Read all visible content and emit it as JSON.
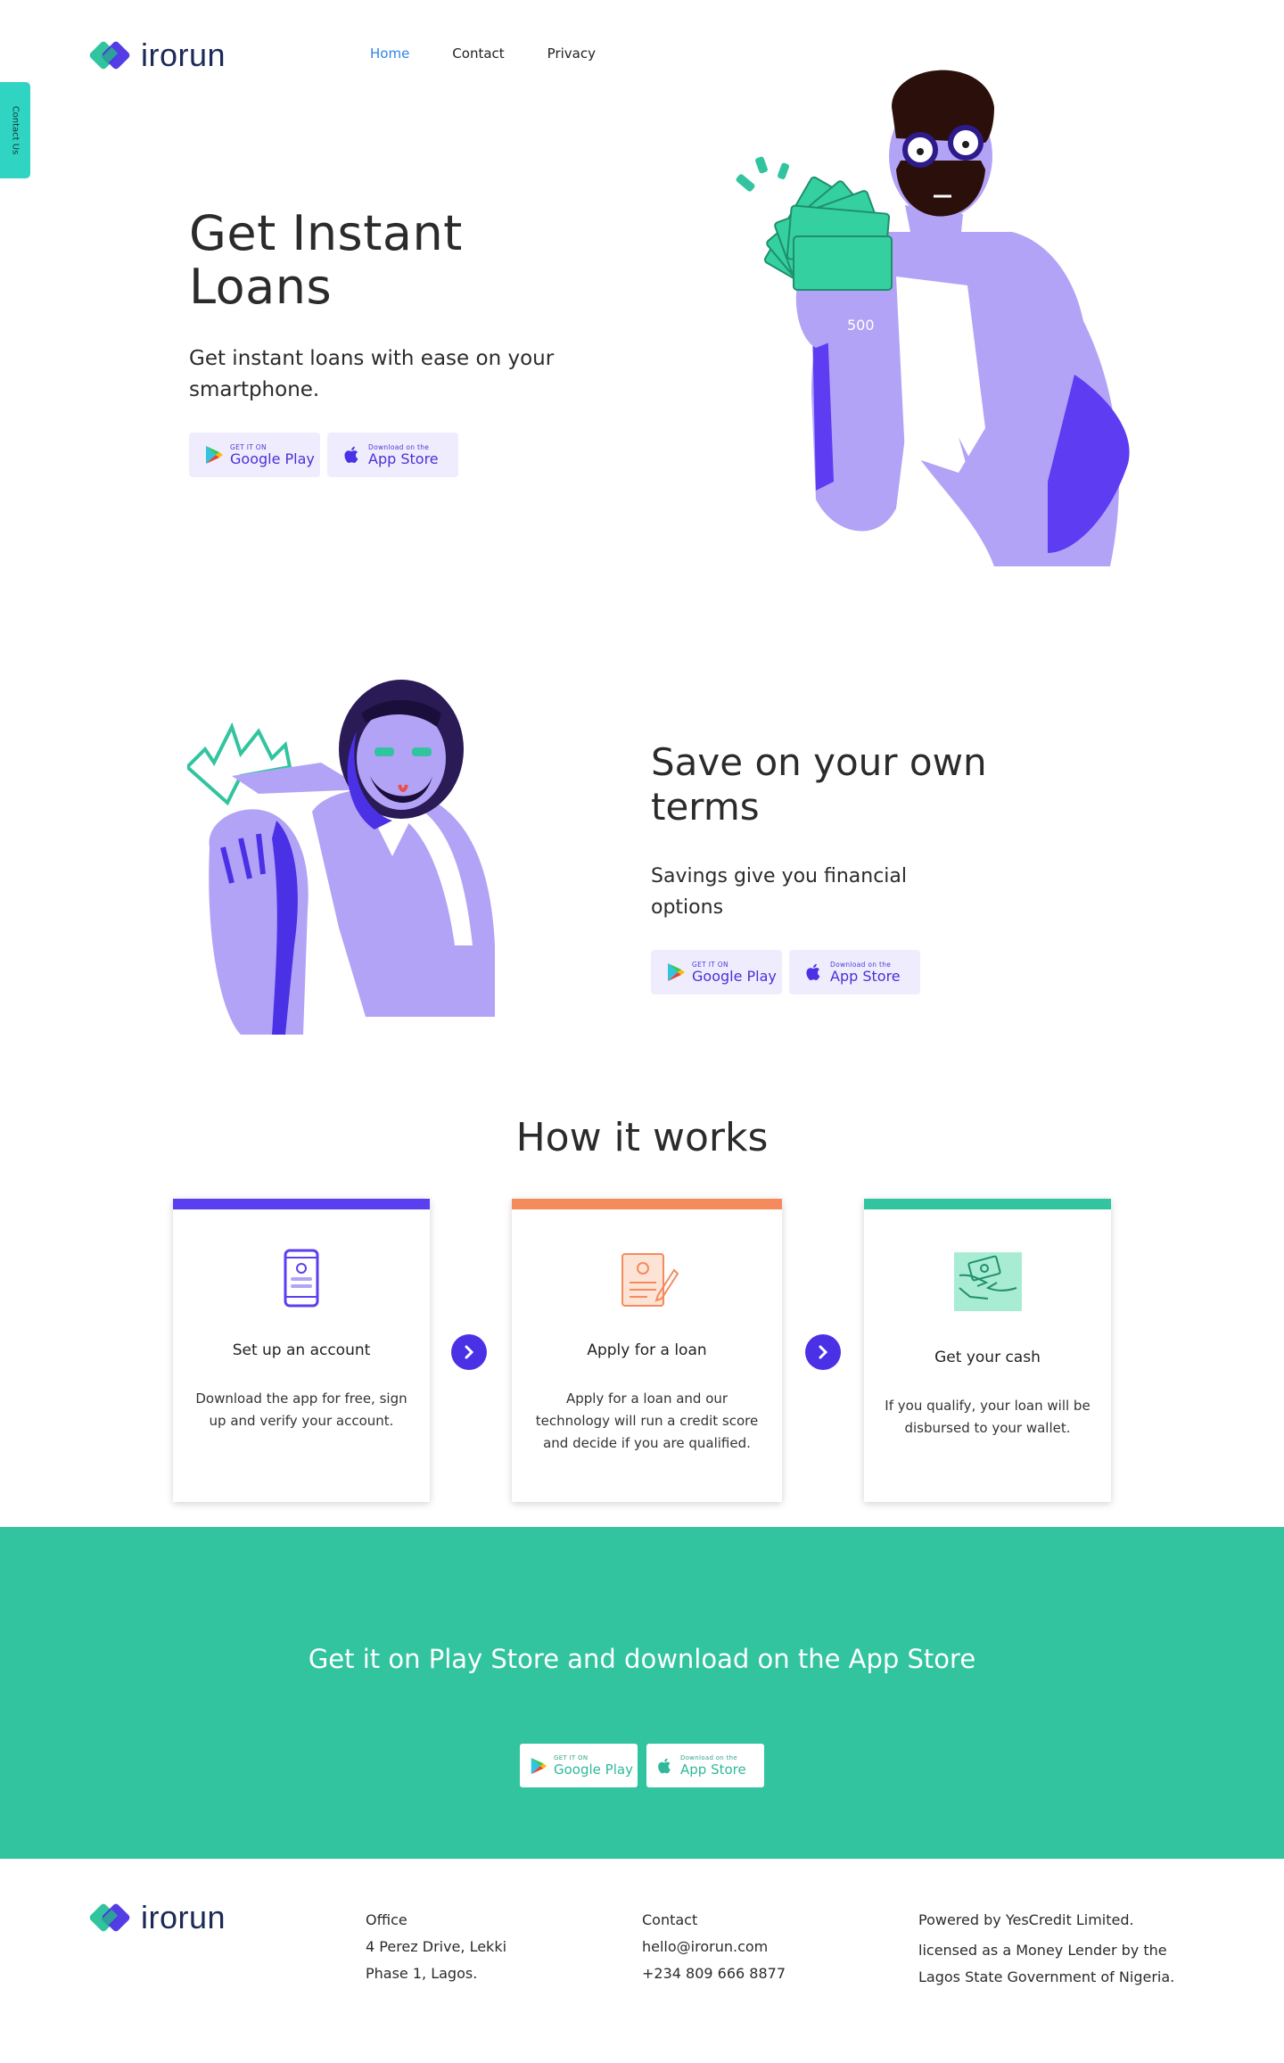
{
  "brand": {
    "name": "irorun",
    "accent": "#4b31e6",
    "teal": "#31c49f"
  },
  "nav": {
    "items": [
      "Home",
      "Contact",
      "Privacy"
    ],
    "active": "Home"
  },
  "contact_tab": {
    "label": "Contact Us"
  },
  "hero": {
    "title": "Get Instant Loans",
    "subtitle": "Get instant loans with ease on your smartphone."
  },
  "stores": {
    "google_small": "GET IT ON",
    "google_big": "Google Play",
    "apple_small": "Download on the",
    "apple_big": "App Store"
  },
  "save": {
    "title": "Save on your own terms",
    "subtitle": "Savings give you financial options"
  },
  "how": {
    "title": "How it works",
    "steps": [
      {
        "title": "Set up an account",
        "desc": "Download the app for free, sign up and verify your account.",
        "color": "#5a3ff0",
        "icon": "phone-icon"
      },
      {
        "title": "Apply for a loan",
        "desc": "Apply for a loan and our technology will run a credit score and decide if you are qualified.",
        "color": "#f58b5d",
        "icon": "application-form-icon"
      },
      {
        "title": "Get your cash",
        "desc": "If you qualify, your loan will be disbursed to your wallet.",
        "color": "#31c49f",
        "icon": "cash-handover-icon"
      }
    ]
  },
  "cta": {
    "title": "Get it on Play Store and download on the App Store"
  },
  "footer": {
    "office_label": "Office",
    "office_line1": "4 Perez Drive, Lekki",
    "office_line2": "Phase 1, Lagos.",
    "contact_label": "Contact",
    "email": "hello@irorun.com",
    "phone": "+234 809 666 8877",
    "powered": "Powered by YesCredit Limited.",
    "license": "licensed as a Money Lender by the Lagos State Government of Nigeria."
  }
}
